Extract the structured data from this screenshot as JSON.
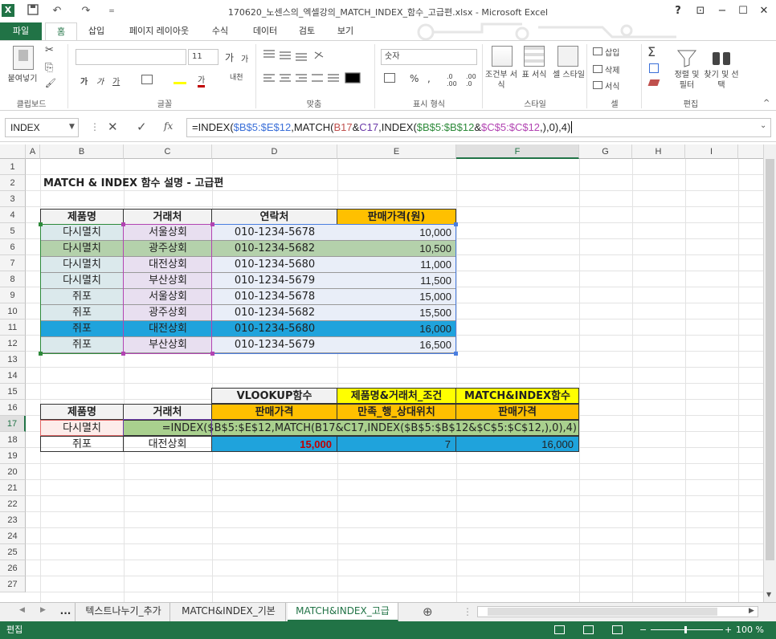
{
  "window": {
    "title": "170620_노센스의_엑셀강의_MATCH_INDEX_함수_고급편.xlsx - Microsoft Excel",
    "help": "?",
    "restore_ribbon": "⊡",
    "min": "−",
    "max": "☐",
    "close": "✕"
  },
  "quick_access": {
    "excel_icon": "X",
    "save": "💾",
    "undo": "↶",
    "redo": "↷",
    "customize": "="
  },
  "ribbon_tabs": [
    "파일",
    "홈",
    "삽입",
    "페이지 레이아웃",
    "수식",
    "데이터",
    "검토",
    "보기"
  ],
  "ribbon": {
    "clipboard": {
      "paste": "붙여넣기",
      "cut": "✂",
      "copy": "⎘",
      "format_painter": "🖌",
      "label": "클립보드"
    },
    "font": {
      "name": "",
      "size": "11",
      "grow": "가",
      "shrink": "가",
      "bold": "가",
      "italic": "가",
      "underline": "가",
      "label": "글꼴",
      "phonetic": "내천"
    },
    "alignment": {
      "label": "맞춤"
    },
    "number": {
      "format": "숫자",
      "percent": "%",
      "comma": ",",
      "label": "표시 형식"
    },
    "styles": {
      "conditional": "조건부 서식",
      "table": "표 서식",
      "cell": "셀 스타일",
      "label": "스타일"
    },
    "cells": {
      "insert": "삽입",
      "delete": "삭제",
      "format": "서식",
      "label": "셀"
    },
    "editing": {
      "sum": "Σ",
      "sort": "정렬 및 필터",
      "find": "찾기 및 선택",
      "label": "편집"
    }
  },
  "formula_bar": {
    "name_box": "INDEX",
    "cancel": "✕",
    "enter": "✓",
    "fx": "fx",
    "formula_parts": [
      "=INDEX(",
      "$B$5:$E$12",
      ",MATCH(",
      "B17",
      "&",
      "C17",
      ",INDEX(",
      "$B$5:$B$12",
      "&",
      "$C$5:$C$12",
      ",),0),4)"
    ]
  },
  "columns": [
    "A",
    "B",
    "C",
    "D",
    "E",
    "F",
    "G",
    "H",
    "I"
  ],
  "rows": [
    "1",
    "2",
    "3",
    "4",
    "5",
    "6",
    "7",
    "8",
    "9",
    "10",
    "11",
    "12",
    "13",
    "14",
    "15",
    "16",
    "17",
    "18",
    "19",
    "20",
    "21",
    "22",
    "23",
    "24",
    "25",
    "26",
    "27"
  ],
  "sheet": {
    "title": "MATCH & INDEX 함수 설명 - 고급편",
    "headers": [
      "제품명",
      "거래처",
      "연락처",
      "판매가격(원)"
    ],
    "data": [
      [
        "다시멸치",
        "서울상회",
        "010-1234-5678",
        "10,000"
      ],
      [
        "다시멸치",
        "광주상회",
        "010-1234-5682",
        "10,500"
      ],
      [
        "다시멸치",
        "대전상회",
        "010-1234-5680",
        "11,000"
      ],
      [
        "다시멸치",
        "부산상회",
        "010-1234-5679",
        "11,500"
      ],
      [
        "쥐포",
        "서울상회",
        "010-1234-5678",
        "15,000"
      ],
      [
        "쥐포",
        "광주상회",
        "010-1234-5682",
        "15,500"
      ],
      [
        "쥐포",
        "대전상회",
        "010-1234-5680",
        "16,000"
      ],
      [
        "쥐포",
        "부산상회",
        "010-1234-5679",
        "16,500"
      ]
    ],
    "lookup": {
      "top_headers": [
        "VLOOKUP함수",
        "제품명&거래처_조건",
        "MATCH&INDEX함수"
      ],
      "sub_headers": [
        "제품명",
        "거래처",
        "판매가격",
        "만족_행_상대위치",
        "판매가격"
      ],
      "row17": {
        "product": "다시멸치",
        "editing_formula": "=INDEX($B$5:$E$12,MATCH(B17&C17,INDEX($B$5:$B$12&$C$5:$C$12,),0),4)"
      },
      "row18": {
        "product": "쥐포",
        "vendor": "대전상회",
        "vlookup": "15,000",
        "position": "7",
        "result": "16,000"
      }
    }
  },
  "sheet_tabs": {
    "more": "...",
    "tabs": [
      "텍스트나누기_추가",
      "MATCH&INDEX_기본",
      "MATCH&INDEX_고급"
    ],
    "active": 2,
    "add": "⊕"
  },
  "status": {
    "mode": "편집",
    "zoom": "100 %"
  }
}
